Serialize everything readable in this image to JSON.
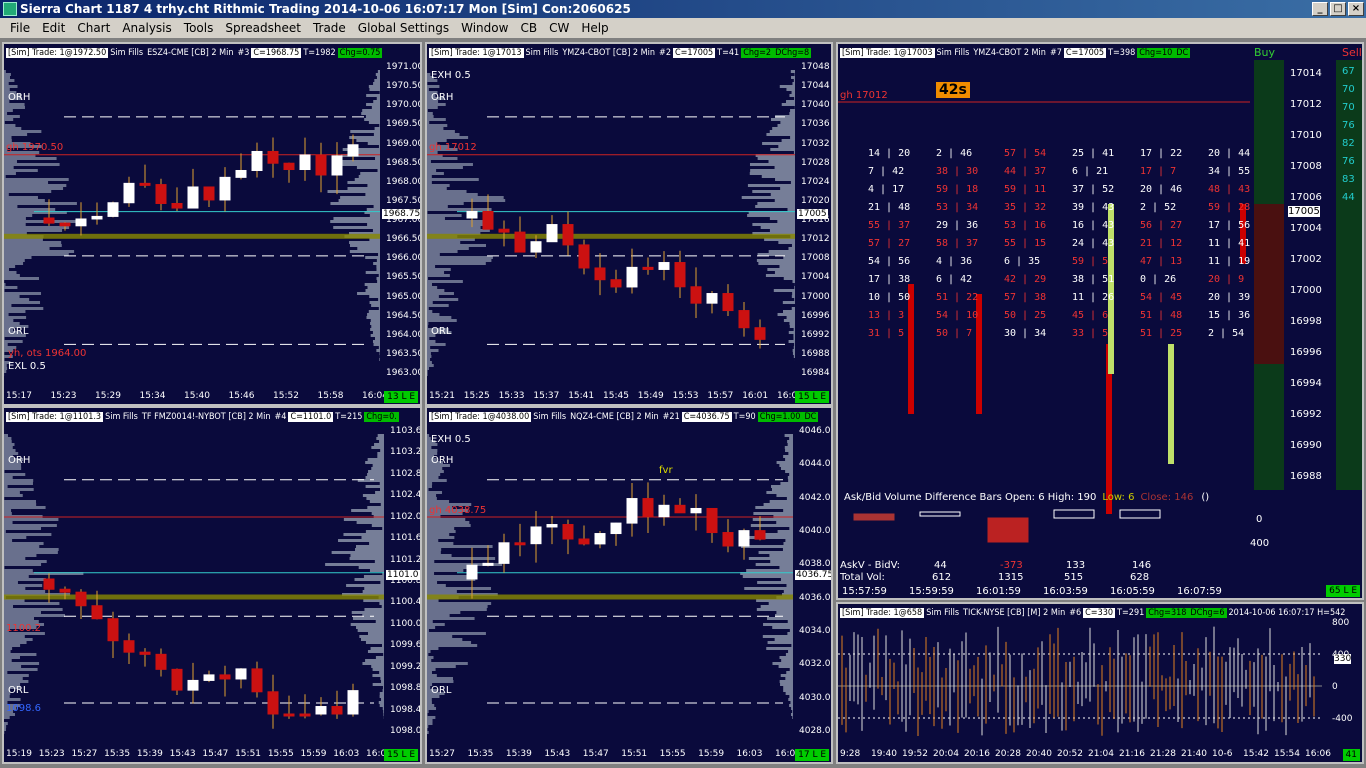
{
  "window": {
    "title": "Sierra Chart 1187 4 trhy.cht  Rithmic Trading 2014-10-06  16:07:17 Mon [Sim]  Con:2060625",
    "min": "_",
    "max": "□",
    "close": "×"
  },
  "menu": [
    "File",
    "Edit",
    "Chart",
    "Analysis",
    "Tools",
    "Spreadsheet",
    "Trade",
    "Global Settings",
    "Window",
    "CB",
    "CW",
    "Help"
  ],
  "colors": {
    "bg": "#0a0a3c",
    "up": "#ffffff",
    "down": "#cc1111",
    "profile": "#8a93a8",
    "red_line": "#cc2222",
    "cyan": "#33cccc",
    "yellow": "#cccc00"
  },
  "charts": [
    {
      "id": "es",
      "sim": "[Sim] Trade: 1@1972.50",
      "fills": "Sim Fills",
      "sym": "ESZ4-CME [CB] 2 Min",
      "num": "#3",
      "c": "C=1968.75",
      "t": "T=1982",
      "chg": "Chg=0.75",
      "yticks": [
        "1971.00",
        "1970.50",
        "1970.00",
        "1969.50",
        "1969.00",
        "1968.50",
        "1968.00",
        "1967.50",
        "1967.00",
        "1966.50",
        "1966.00",
        "1965.50",
        "1965.00",
        "1964.50",
        "1964.00",
        "1963.50",
        "1963.00"
      ],
      "xticks": [
        "15:17",
        "15:23",
        "15:29",
        "15:34",
        "15:40",
        "15:46",
        "15:52",
        "15:58",
        "16:04"
      ],
      "badge": "13 L E",
      "price": "1968.75",
      "labels": {
        "orh": "ORH",
        "gh": "gh  1970.50",
        "orl": "ORL",
        "yh": "yh, ots  1964.00",
        "exl": "EXL 0.5"
      }
    },
    {
      "id": "ym",
      "sim": "[Sim] Trade: 1@17013",
      "fills": "Sim Fills",
      "sym": "YMZ4-CBOT [CB] 2 Min",
      "num": "#2",
      "c": "C=17005",
      "t": "T=41",
      "chg": "Chg=2",
      "dchg": "DChg=8",
      "yticks": [
        "17048",
        "17044",
        "17040",
        "17036",
        "17032",
        "17028",
        "17024",
        "17020",
        "17016",
        "17012",
        "17008",
        "17004",
        "17000",
        "16996",
        "16992",
        "16988",
        "16984"
      ],
      "xticks": [
        "15:21",
        "15:25",
        "15:33",
        "15:37",
        "15:41",
        "15:45",
        "15:49",
        "15:53",
        "15:57",
        "16:01",
        "16:05"
      ],
      "badge": "15 L E",
      "price": "17005",
      "labels": {
        "exh": "EXH 0.5",
        "orh": "ORH",
        "gh": "gh  17012",
        "orl": "ORL"
      }
    },
    {
      "id": "tf",
      "sim": "[Sim] Trade: 1@1101.3",
      "fills": "Sim Fills",
      "sym": "TF FMZ0014!-NYBOT [CB] 2 Min",
      "num": "#4",
      "c": "C=1101.0",
      "t": "T=215",
      "chg": "Chg=0.",
      "yticks": [
        "1103.6",
        "1103.2",
        "1102.8",
        "1102.4",
        "1102.0",
        "1101.6",
        "1101.2",
        "1100.8",
        "1100.4",
        "1100.0",
        "1099.6",
        "1099.2",
        "1098.8",
        "1098.4",
        "1098.0"
      ],
      "xticks": [
        "15:19",
        "15:23",
        "15:27",
        "15:35",
        "15:39",
        "15:43",
        "15:47",
        "15:51",
        "15:55",
        "15:59",
        "16:03",
        "16:07"
      ],
      "badge": "15 L E",
      "price": "1101.0",
      "labels": {
        "orh": "ORH",
        "red": "1100.2",
        "blue": "1098.6",
        "orl": "ORL"
      }
    },
    {
      "id": "nq",
      "sim": "[Sim] Trade: 1@4038.00",
      "fills": "Sim Fills",
      "sym": "NQZ4-CME [CB] 2 Min",
      "num": "#21",
      "c": "C=4036.75",
      "t": "T=90",
      "chg": "Chg=1.00",
      "dchg": "DC",
      "yticks": [
        "4046.00",
        "4044.00",
        "4042.00",
        "4040.00",
        "4038.00",
        "4036.00",
        "4034.00",
        "4032.00",
        "4030.00",
        "4028.00"
      ],
      "xticks": [
        "15:27",
        "15:35",
        "15:39",
        "15:43",
        "15:47",
        "15:51",
        "15:55",
        "15:59",
        "16:03",
        "16:07"
      ],
      "badge": "17 L E",
      "price": "4036.75",
      "labels": {
        "exh": "EXH 0.5",
        "orh": "ORH",
        "gh": "gh  4038.75",
        "orl": "ORL",
        "fvr": "fvr"
      }
    },
    {
      "id": "dom",
      "sim": "[Sim]  Trade: 1@17003",
      "fills": "Sim Fills",
      "sym": "YMZ4-CBOT  2 Min",
      "num": "#7",
      "c": "C=17005",
      "t": "T=398",
      "chg": "Chg=10",
      "dchg": "DC",
      "buy": "Buy",
      "sell": "Sell",
      "timer": "42s",
      "gh": "gh  17012",
      "yticks": [
        "17014",
        "17012",
        "17010",
        "17008",
        "17006",
        "17004",
        "17002",
        "17000",
        "16998",
        "16996",
        "16994",
        "16992",
        "16990",
        "16988"
      ],
      "price": "17005",
      "sellq": [
        "67",
        "70",
        "70",
        "76",
        "82",
        "76",
        "83",
        "44"
      ],
      "barsTitle": "Ask/Bid Volume Difference Bars  Open: 6  High: 190",
      "low": "Low: 6",
      "close": "Close: 146",
      "paren": "()",
      "askbid": "AskV - BidV:",
      "totvol": "Total Vol:",
      "abvals": [
        "44",
        "-373",
        "133",
        "146"
      ],
      "tvvals": [
        "612",
        "1315",
        "515",
        "628"
      ],
      "times": [
        "15:57:59",
        "15:59:59",
        "16:01:59",
        "16:03:59",
        "16:05:59",
        "16:07:59"
      ],
      "zero": "0",
      "four": "400",
      "badge": "65 L E"
    },
    {
      "id": "tick",
      "sim": "[Sim] Trade: 1@658",
      "fills": "Sim Fills",
      "sym": "TICK-NYSE [CB] [M] 2 Min",
      "num": "#6",
      "c": "C=330",
      "t": "T=291",
      "chg": "Chg=318",
      "dchg": "DChg=6",
      "extra": "2014-10-06 16:07:17 H=542",
      "yticks": [
        "800",
        "400",
        "0",
        "-400"
      ],
      "last": "330",
      "xticks": [
        "9:28",
        "19:40",
        "19:52",
        "20:04",
        "20:16",
        "20:28",
        "20:40",
        "20:52",
        "21:04",
        "21:16",
        "21:28",
        "21:40",
        "10-6",
        "15:42",
        "15:54",
        "16:06"
      ],
      "badge": "41"
    }
  ]
}
